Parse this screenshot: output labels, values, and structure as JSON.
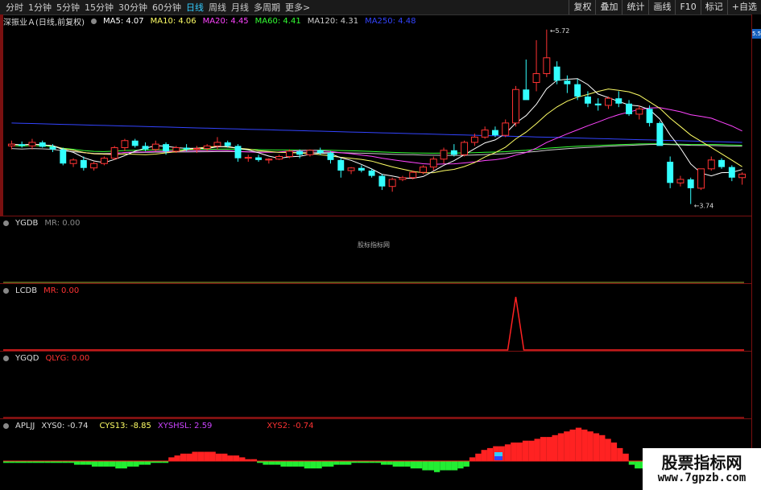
{
  "toolbar": {
    "periods": [
      "分时",
      "1分钟",
      "5分钟",
      "15分钟",
      "30分钟",
      "60分钟",
      "日线",
      "周线",
      "月线",
      "多周期",
      "更多>"
    ],
    "active_period": "日线",
    "tools": [
      "复权",
      "叠加",
      "统计",
      "画线",
      "F10",
      "标记",
      "+自选"
    ]
  },
  "main_info": {
    "stock": "深振业Ａ(日线,前复权)",
    "ma5": "MA5: 4.07",
    "ma10": "MA10: 4.06",
    "ma20": "MA20: 4.45",
    "ma60": "MA60: 4.41",
    "ma120": "MA120: 4.31",
    "ma250": "MA250: 4.48",
    "high_label": "5.72",
    "low_label": "3.74",
    "right_badge": "5.5"
  },
  "indicators": {
    "ygdb": {
      "name": "YGDB",
      "mr": "MR: 0.00"
    },
    "lcdb": {
      "name": "LCDB",
      "mr": "MR: 0.00"
    },
    "ygqd": {
      "name": "YGQD",
      "qlyg": "QLYG: 0.00"
    },
    "aplj": {
      "name": "APLJJ",
      "xys0": "XYS0: -0.74",
      "cys13": "CYS13: -8.85",
      "xyshsl": "XYSHSL: 2.59",
      "xys2": "XYS2: -0.74"
    }
  },
  "center_label": "股标指标网",
  "watermark": {
    "line1": "股票指标网",
    "line2": "www.7gpzb.com"
  },
  "colors": {
    "up": "#ff3333",
    "down": "#33ffff",
    "ma5": "#ffffff",
    "ma10": "#ffff66",
    "ma20": "#ff44ff",
    "ma60": "#33ff33",
    "ma120": "#cccccc",
    "ma250": "#3344ff"
  },
  "chart_data": {
    "type": "candlestick",
    "ohlc": [
      [
        4.4,
        4.46,
        4.36,
        4.42
      ],
      [
        4.42,
        4.45,
        4.38,
        4.4
      ],
      [
        4.4,
        4.48,
        4.36,
        4.44
      ],
      [
        4.44,
        4.46,
        4.38,
        4.39
      ],
      [
        4.39,
        4.42,
        4.33,
        4.36
      ],
      [
        4.36,
        4.38,
        4.18,
        4.2
      ],
      [
        4.2,
        4.26,
        4.16,
        4.24
      ],
      [
        4.24,
        4.28,
        4.12,
        4.15
      ],
      [
        4.15,
        4.22,
        4.12,
        4.2
      ],
      [
        4.2,
        4.28,
        4.18,
        4.26
      ],
      [
        4.26,
        4.4,
        4.24,
        4.38
      ],
      [
        4.38,
        4.48,
        4.34,
        4.46
      ],
      [
        4.46,
        4.48,
        4.38,
        4.4
      ],
      [
        4.4,
        4.44,
        4.34,
        4.36
      ],
      [
        4.36,
        4.46,
        4.34,
        4.42
      ],
      [
        4.42,
        4.44,
        4.3,
        4.34
      ],
      [
        4.34,
        4.4,
        4.32,
        4.38
      ],
      [
        4.38,
        4.42,
        4.34,
        4.36
      ],
      [
        4.36,
        4.4,
        4.32,
        4.37
      ],
      [
        4.37,
        4.42,
        4.34,
        4.4
      ],
      [
        4.4,
        4.5,
        4.36,
        4.44
      ],
      [
        4.44,
        4.46,
        4.38,
        4.4
      ],
      [
        4.4,
        4.42,
        4.22,
        4.26
      ],
      [
        4.26,
        4.3,
        4.22,
        4.27
      ],
      [
        4.27,
        4.3,
        4.22,
        4.24
      ],
      [
        4.24,
        4.26,
        4.2,
        4.25
      ],
      [
        4.25,
        4.3,
        4.24,
        4.28
      ],
      [
        4.28,
        4.36,
        4.26,
        4.34
      ],
      [
        4.34,
        4.36,
        4.26,
        4.3
      ],
      [
        4.3,
        4.36,
        4.28,
        4.35
      ],
      [
        4.35,
        4.38,
        4.3,
        4.32
      ],
      [
        4.32,
        4.34,
        4.2,
        4.24
      ],
      [
        4.24,
        4.26,
        4.04,
        4.12
      ],
      [
        4.12,
        4.16,
        4.08,
        4.15
      ],
      [
        4.15,
        4.18,
        4.1,
        4.12
      ],
      [
        4.12,
        4.14,
        4.04,
        4.06
      ],
      [
        4.06,
        4.08,
        3.9,
        3.94
      ],
      [
        3.94,
        4.04,
        3.88,
        4.02
      ],
      [
        4.02,
        4.06,
        4.0,
        4.04
      ],
      [
        4.04,
        4.12,
        4.02,
        4.1
      ],
      [
        4.1,
        4.18,
        4.08,
        4.16
      ],
      [
        4.16,
        4.28,
        4.12,
        4.25
      ],
      [
        4.25,
        4.38,
        4.2,
        4.35
      ],
      [
        4.35,
        4.42,
        4.28,
        4.3
      ],
      [
        4.3,
        4.46,
        4.28,
        4.44
      ],
      [
        4.44,
        4.54,
        4.4,
        4.5
      ],
      [
        4.5,
        4.62,
        4.48,
        4.58
      ],
      [
        4.58,
        4.62,
        4.5,
        4.52
      ],
      [
        4.52,
        4.7,
        4.5,
        4.66
      ],
      [
        4.66,
        5.08,
        4.62,
        5.04
      ],
      [
        5.04,
        5.38,
        4.98,
        4.92
      ],
      [
        5.12,
        5.6,
        5.02,
        5.22
      ],
      [
        5.22,
        5.72,
        5.18,
        5.4
      ],
      [
        5.3,
        5.36,
        5.1,
        5.14
      ],
      [
        5.14,
        5.2,
        5.0,
        5.1
      ],
      [
        5.1,
        5.16,
        4.92,
        4.96
      ],
      [
        4.96,
        5.02,
        4.84,
        4.88
      ],
      [
        4.88,
        4.94,
        4.8,
        4.86
      ],
      [
        4.86,
        4.96,
        4.82,
        4.94
      ],
      [
        4.94,
        5.02,
        4.84,
        4.88
      ],
      [
        4.88,
        4.92,
        4.74,
        4.76
      ],
      [
        4.76,
        4.86,
        4.7,
        4.82
      ],
      [
        4.82,
        4.86,
        4.62,
        4.66
      ],
      [
        4.66,
        4.68,
        4.44,
        4.4
      ],
      [
        4.22,
        4.28,
        3.92,
        3.98
      ],
      [
        3.98,
        4.06,
        3.94,
        4.02
      ],
      [
        4.02,
        4.04,
        3.74,
        3.92
      ],
      [
        3.92,
        4.1,
        3.9,
        4.14
      ],
      [
        4.14,
        4.28,
        4.12,
        4.24
      ],
      [
        4.24,
        4.26,
        4.14,
        4.16
      ],
      [
        4.16,
        4.18,
        4.0,
        4.04
      ],
      [
        4.04,
        4.1,
        3.96,
        4.08
      ]
    ],
    "ma250_start": 4.66,
    "ma250_end": 4.44,
    "lcdb_spike_index": 49,
    "aplj_bars": [
      -1,
      -1,
      -1,
      -1,
      -1,
      -1,
      -1,
      -1,
      -1,
      -1,
      -1,
      -1,
      -2,
      -2,
      -2,
      -3,
      -3,
      -3,
      -3,
      -4,
      -4,
      -3,
      -3,
      -2,
      -2,
      -1,
      -1,
      -1,
      2,
      3,
      4,
      4,
      5,
      5,
      5,
      5,
      4,
      4,
      3,
      3,
      2,
      1,
      1,
      -1,
      -2,
      -2,
      -2,
      -3,
      -3,
      -3,
      -3,
      -4,
      -4,
      -4,
      -3,
      -3,
      -2,
      -2,
      -2,
      -1,
      -1,
      -1,
      -1,
      -1,
      -2,
      -2,
      -3,
      -3,
      -3,
      -4,
      -4,
      -5,
      -5,
      -6,
      -5,
      -5,
      -5,
      -4,
      -3,
      2,
      4,
      6,
      7,
      8,
      8,
      9,
      10,
      10,
      11,
      11,
      12,
      13,
      13,
      14,
      15,
      16,
      17,
      18,
      17,
      16,
      15,
      14,
      12,
      10,
      7,
      4,
      -2,
      -4,
      -4,
      -5,
      -5,
      -5,
      -5,
      -5,
      -5,
      -6,
      -6,
      -6,
      -6,
      -5,
      -5,
      -5,
      -6,
      -6,
      -6
    ]
  }
}
